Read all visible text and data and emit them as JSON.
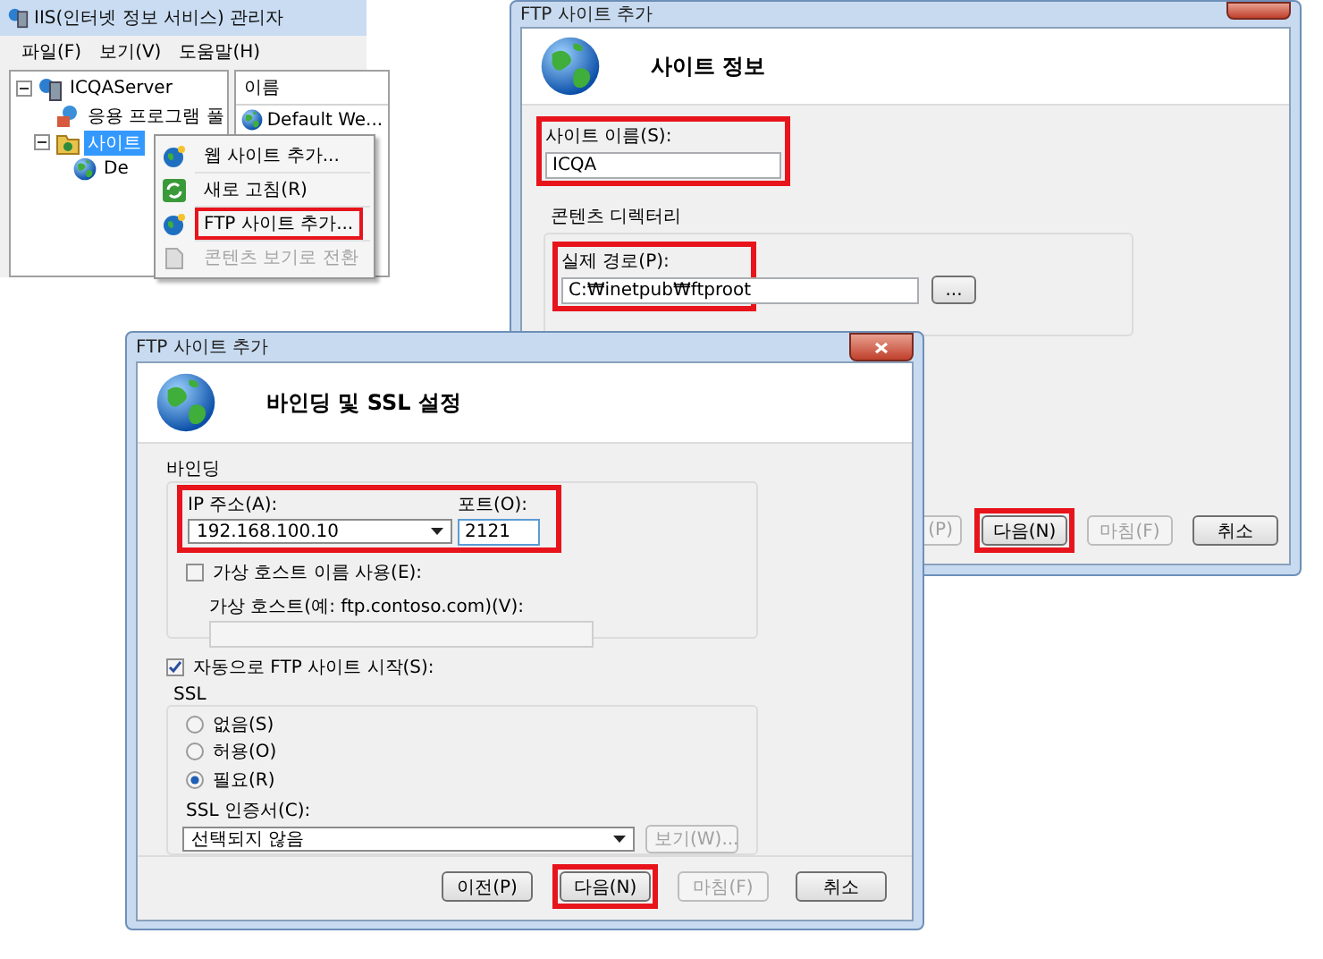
{
  "iis_manager": {
    "title": "IIS(인터넷 정보 서비스) 관리자",
    "menu": [
      "파일(F)",
      "보기(V)",
      "도움말(H)"
    ],
    "tree": [
      {
        "label": "ICQAServer",
        "expanded": true,
        "selected": false,
        "children": [
          {
            "label": "응용 프로그램 풀",
            "selected": false
          },
          {
            "label": "사이트",
            "expanded": true,
            "selected": true,
            "children": [
              {
                "label": "De",
                "selected": false
              }
            ]
          }
        ]
      }
    ],
    "list": {
      "columns": [
        "이름"
      ],
      "rows": [
        "Default We..."
      ]
    },
    "context_menu": [
      {
        "label": "웹 사이트 추가...",
        "disabled": false,
        "highlighted": false
      },
      {
        "label": "새로 고침(R)",
        "disabled": false,
        "highlighted": false
      },
      {
        "label": "FTP 사이트 추가...",
        "disabled": false,
        "highlighted": true
      },
      {
        "label": "콘텐츠 보기로 전환",
        "disabled": true,
        "highlighted": false
      }
    ]
  },
  "site_info_dialog": {
    "title": "FTP 사이트 추가",
    "heading": "사이트 정보",
    "site_name": {
      "label": "사이트 이름(S):",
      "value": "ICQA",
      "highlighted": true
    },
    "content_directory": {
      "group_label": "콘텐츠 디렉터리",
      "path_label": "실제 경로(P):",
      "path_value": "C:₩inetpub₩ftproot",
      "highlighted": true,
      "browse_button": "..."
    },
    "buttons": [
      {
        "label": "(P)",
        "disabled": true
      },
      {
        "label": "다음(N)",
        "disabled": false,
        "highlighted": true
      },
      {
        "label": "마침(F)",
        "disabled": true,
        "highlighted": false
      },
      {
        "label": "취소",
        "disabled": false,
        "highlighted": false
      }
    ]
  },
  "binding_dialog": {
    "title": "FTP 사이트 추가",
    "heading": "바인딩 및 SSL 설정",
    "binding": {
      "group_label": "바인딩",
      "ip_label": "IP 주소(A):",
      "ip_value": "192.168.100.10",
      "port_label": "포트(O):",
      "port_value": "2121",
      "highlighted": true,
      "virtual_host": {
        "label": "가상 호스트 이름 사용(E):",
        "checked": false
      },
      "virtual_host_name": {
        "label": "가상 호스트(예: ftp.contoso.com)(V):",
        "disabled": true
      }
    },
    "auto_start": {
      "label": "자동으로 FTP 사이트 시작(S):",
      "checked": true
    },
    "ssl": {
      "group_label": "SSL",
      "options": [
        {
          "label": "없음(S)",
          "selected": false
        },
        {
          "label": "허용(O)",
          "selected": false
        },
        {
          "label": "필요(R)",
          "selected": true
        }
      ],
      "certificate_label": "SSL 인증서(C):",
      "certificate_value": "선택되지 않음",
      "view_button": {
        "label": "보기(W)...",
        "disabled": true
      }
    },
    "buttons": [
      {
        "label": "이전(P)",
        "disabled": false,
        "highlighted": false
      },
      {
        "label": "다음(N)",
        "disabled": false,
        "highlighted": true
      },
      {
        "label": "마침(F)",
        "disabled": true,
        "highlighted": false
      },
      {
        "label": "취소",
        "disabled": false,
        "highlighted": false
      }
    ]
  }
}
